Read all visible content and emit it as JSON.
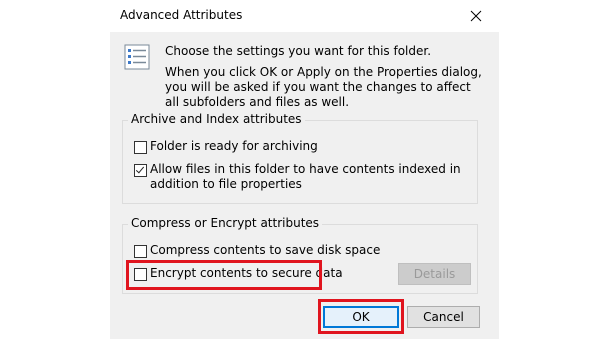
{
  "dialog": {
    "title": "Advanced Attributes",
    "close_icon": "close-icon"
  },
  "info": {
    "icon": "attributes-list-icon",
    "line1": "Choose the settings you want for this folder.",
    "line2": "When you click OK or Apply on the Properties dialog, you will be asked if you want the changes to affect all subfolders and files as well."
  },
  "archive_group": {
    "label": "Archive and Index attributes",
    "items": [
      {
        "label": "Folder is ready for archiving",
        "checked": false
      },
      {
        "label": "Allow files in this folder to have contents indexed in addition to file properties",
        "checked": true
      }
    ]
  },
  "compress_group": {
    "label": "Compress or Encrypt attributes",
    "items": [
      {
        "label": "Compress contents to save disk space",
        "checked": false
      },
      {
        "label": "Encrypt contents to secure data",
        "checked": false
      }
    ],
    "details_label": "Details"
  },
  "buttons": {
    "ok_label": "OK",
    "cancel_label": "Cancel"
  },
  "colors": {
    "highlight": "#e0141e",
    "accent": "#0078d7",
    "dialog_bg": "#f0f0f0"
  }
}
